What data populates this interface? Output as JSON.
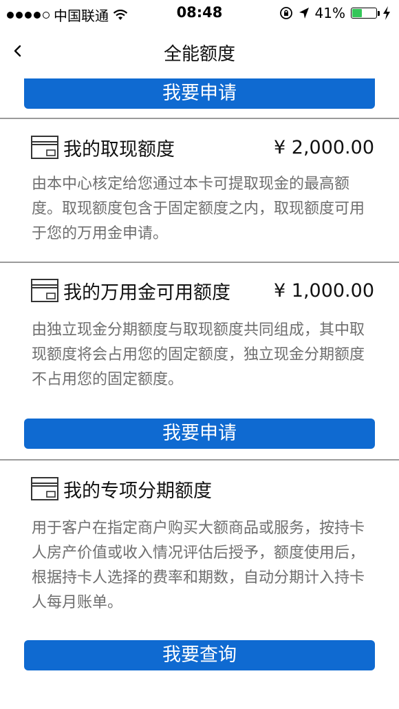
{
  "status_bar": {
    "carrier": "中国联通",
    "time": "08:48",
    "battery_percent": "41%",
    "battery_level": 0.41,
    "battery_color": "#34c759"
  },
  "nav": {
    "title": "全能额度",
    "back_icon": "chevron-left-icon"
  },
  "buttons": {
    "top_apply": "我要申请",
    "mid_apply": "我要申请",
    "bottom_query": "我要查询"
  },
  "sections": [
    {
      "title": "我的取现额度",
      "amount": "¥ 2,000.00",
      "description": "由本中心核定给您通过本卡可提取现金的最高额度。取现额度包含于固定额度之内，取现额度可用于您的万用金申请。"
    },
    {
      "title": "我的万用金可用额度",
      "amount": "¥ 1,000.00",
      "description": "由独立现金分期额度与取现额度共同组成，其中取现额度将会占用您的固定额度，独立现金分期额度不占用您的固定额度。"
    },
    {
      "title": "我的专项分期额度",
      "amount": "",
      "description": "用于客户在指定商户购买大额商品或服务，按持卡人房产价值或收入情况评估后授予，额度使用后，根据持卡人选择的费率和期数，自动分期计入持卡人每月账单。"
    }
  ],
  "colors": {
    "button": "#0f6ad1",
    "desc_text": "#6e6e6e",
    "separator": "#9a9a9a"
  }
}
